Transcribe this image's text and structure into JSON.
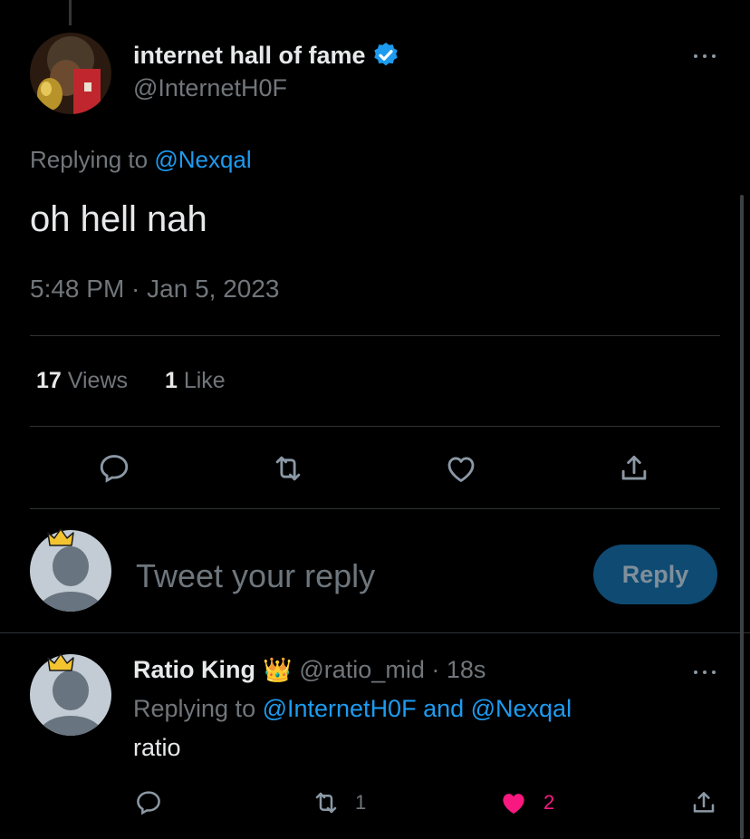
{
  "main_tweet": {
    "author_name": "internet hall of fame",
    "author_handle": "@InternetH0F",
    "replying_prefix": "Replying to ",
    "replying_to": "@Nexqal",
    "text": "oh hell nah",
    "timestamp": "5:48 PM · Jan 5, 2023",
    "views_count": "17",
    "views_label": "Views",
    "likes_count": "1",
    "likes_label": "Like"
  },
  "composer": {
    "placeholder": "Tweet your reply",
    "button_label": "Reply"
  },
  "reply_tweet": {
    "author_name": "Ratio King",
    "author_emoji": "👑",
    "handle_time": "@ratio_mid · 18s",
    "replying_prefix": "Replying to ",
    "replying_to": "@InternetH0F and @Nexqal",
    "text": "ratio",
    "retweet_count": "1",
    "like_count": "2"
  },
  "colors": {
    "background": "#000000",
    "link": "#1d9bf0",
    "verified": "#1d9bf0",
    "liked": "#f91880",
    "muted": "#71767b",
    "reply_button_bg": "#0e4a72"
  },
  "icons": [
    "verified-badge-icon",
    "more-icon",
    "comment-icon",
    "retweet-icon",
    "like-icon",
    "share-icon",
    "crown-icon"
  ]
}
